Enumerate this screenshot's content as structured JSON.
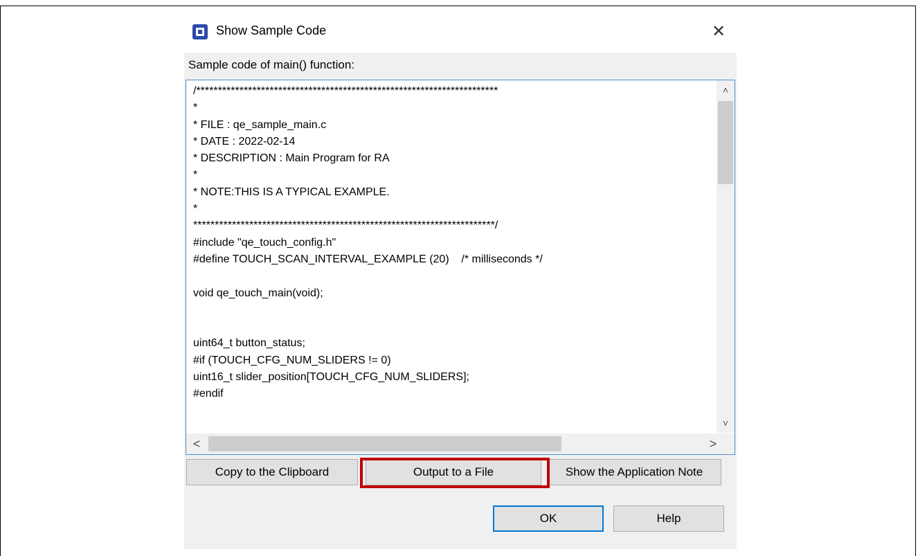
{
  "dialog": {
    "title": "Show Sample Code",
    "close_glyph": "✕",
    "icon": "renesas-app-icon"
  },
  "section_label": "Sample code of main() function:",
  "code_lines": [
    "/**********************************************************************",
    "*",
    "* FILE : qe_sample_main.c",
    "* DATE : 2022-02-14",
    "* DESCRIPTION : Main Program for RA",
    "*",
    "* NOTE:THIS IS A TYPICAL EXAMPLE.",
    "*",
    "**********************************************************************/",
    "#include \"qe_touch_config.h\"",
    "#define TOUCH_SCAN_INTERVAL_EXAMPLE (20)    /* milliseconds */",
    "",
    "void qe_touch_main(void);",
    "",
    "",
    "uint64_t button_status;",
    "#if (TOUCH_CFG_NUM_SLIDERS != 0)",
    "uint16_t slider_position[TOUCH_CFG_NUM_SLIDERS];",
    "#endif"
  ],
  "buttons": {
    "copy": "Copy to the Clipboard",
    "output": "Output to a File",
    "appnote": "Show the Application Note",
    "ok": "OK",
    "help": "Help"
  },
  "scroll": {
    "up": "˄",
    "down": "˅",
    "left": "<",
    "right": ">"
  },
  "colors": {
    "highlight": "#c00000",
    "focus": "#0078d7"
  }
}
